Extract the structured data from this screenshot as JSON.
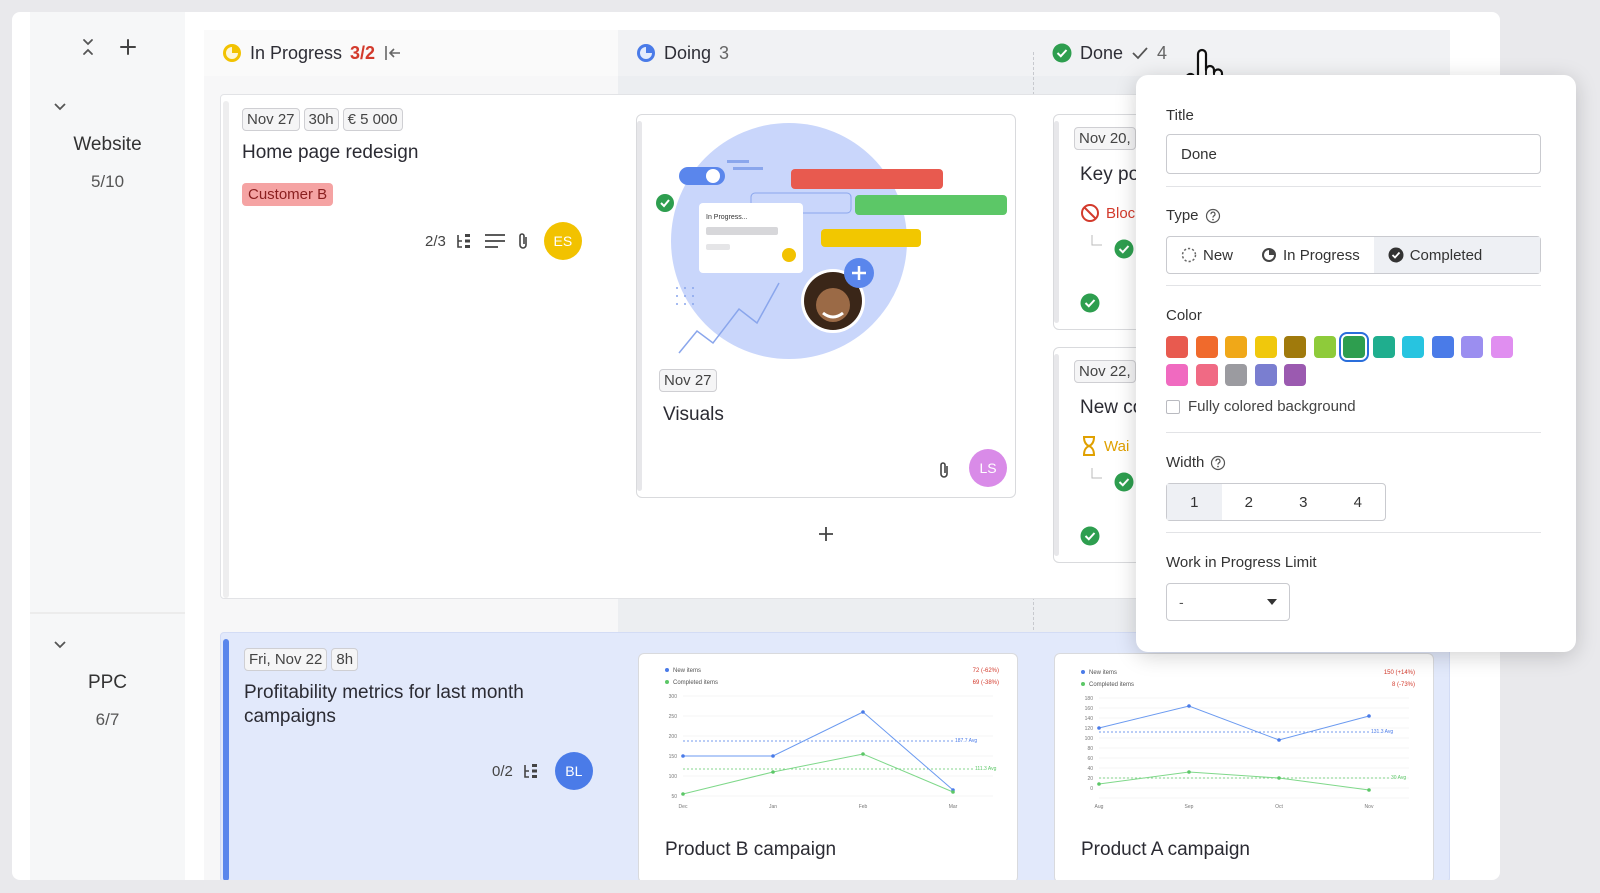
{
  "toolbar": {
    "collapse_icon": "collapse-icon",
    "add_icon": "plus-icon"
  },
  "lanes": [
    {
      "name": "Website",
      "count": "5/10"
    },
    {
      "name": "PPC",
      "count": "6/7"
    }
  ],
  "columns": [
    {
      "name": "In Progress",
      "count": "3/2",
      "color": "#f2c200"
    },
    {
      "name": "Doing",
      "count": "3",
      "color": "#4a7be8"
    },
    {
      "name": "Done",
      "count": "4",
      "color": "#2e9e4f"
    }
  ],
  "cards": {
    "home": {
      "date": "Nov 27",
      "hours": "30h",
      "amount": "€ 5 000",
      "title": "Home page redesign",
      "label": "Customer B",
      "subtasks": "2/3",
      "avatar": "ES",
      "avatar_color": "#f2c200"
    },
    "visuals": {
      "date": "Nov 27",
      "title": "Visuals",
      "avatar": "LS",
      "avatar_color": "#d98be8",
      "illustration_label": "In Progress..."
    },
    "key": {
      "date": "Nov 20,",
      "title": "Key po",
      "status": "Bloc"
    },
    "newc": {
      "date": "Nov 22,",
      "title": "New co",
      "status": "Wai"
    },
    "profit": {
      "date": "Fri, Nov 22",
      "hours": "8h",
      "title": "Profitability metrics for last month campaigns",
      "subtasks": "0/2",
      "avatar": "BL",
      "avatar_color": "#4a7be8"
    },
    "productB": {
      "title": "Product B campaign",
      "legend_new": "New items",
      "legend_completed": "Completed items",
      "stat_new": "72 (-62%)",
      "stat_completed": "69 (-38%)",
      "avg_new": "187.7 Avg",
      "avg_completed": "111.3 Avg",
      "months": [
        "Dec",
        "Jan",
        "Feb",
        "Mar"
      ]
    },
    "productA": {
      "title": "Product A campaign",
      "legend_new": "New items",
      "legend_completed": "Completed items",
      "stat_new": "150 (+14%)",
      "stat_completed": "8 (-73%)",
      "avg_new": "131.3 Avg",
      "avg_completed": "30 Avg",
      "months": [
        "Aug",
        "Sep",
        "Oct",
        "Nov"
      ]
    }
  },
  "add_card_icon": "plus-icon",
  "popup": {
    "title_label": "Title",
    "title_value": "Done",
    "type_label": "Type",
    "type_options": [
      "New",
      "In Progress",
      "Completed"
    ],
    "type_selected": "Completed",
    "color_label": "Color",
    "colors": [
      "#e85a4f",
      "#f06a2c",
      "#f0a818",
      "#f0c80c",
      "#a07a0c",
      "#8ecb3a",
      "#2e9e4f",
      "#1fae8e",
      "#27c4e0",
      "#4a7be8",
      "#9b8ef0",
      "#e08ef0",
      "#f06ac0",
      "#f06a84",
      "#9b9ba0",
      "#7a7ed0",
      "#9b5ab0"
    ],
    "color_selected": "#2e9e4f",
    "fully_colored_label": "Fully colored background",
    "width_label": "Width",
    "width_options": [
      "1",
      "2",
      "3",
      "4"
    ],
    "width_selected": "1",
    "wip_label": "Work in Progress Limit",
    "wip_value": "-"
  }
}
